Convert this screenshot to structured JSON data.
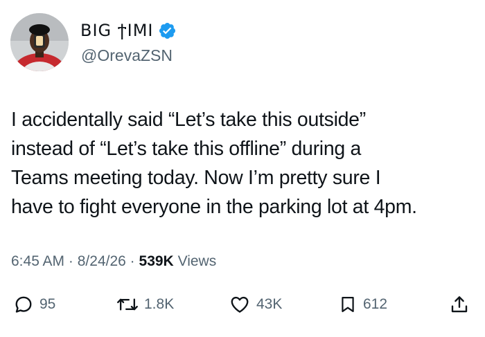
{
  "author": {
    "display_name": "BIG ϯIMI",
    "handle": "@OrevaZSN",
    "verified_color": "#1d9bf0"
  },
  "tweet": {
    "lines": [
      "I accidentally said “Let’s take this outside”",
      "instead of “Let’s take this offline” during a",
      "Teams meeting today. Now I’m pretty sure I",
      "have to fight everyone in the parking lot at 4pm."
    ],
    "time": "6:45 AM",
    "date": "8/24/26",
    "separator": "·",
    "views_count": "539K",
    "views_label": "Views"
  },
  "actions": {
    "replies": "95",
    "retweets": "1.8K",
    "likes": "43K",
    "bookmarks": "612"
  },
  "icons": [
    "verified-badge-icon",
    "reply-icon",
    "retweet-icon",
    "like-icon",
    "bookmark-icon",
    "share-icon"
  ],
  "colors": {
    "text": "#0f1419",
    "secondary": "#536471",
    "accent": "#1d9bf0"
  }
}
